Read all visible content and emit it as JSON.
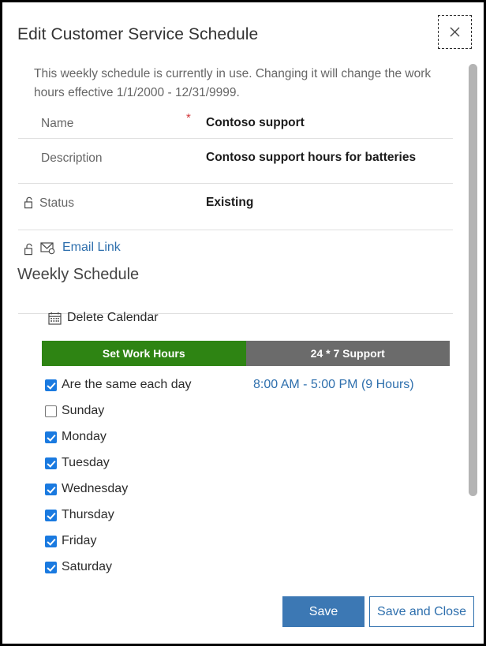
{
  "dialog": {
    "title": "Edit Customer Service Schedule",
    "close_icon": "close-icon",
    "notice": "This weekly schedule is currently in use. Changing it will change the work hours effective 1/1/2000 - 12/31/9999."
  },
  "fields": {
    "name": {
      "label": "Name",
      "required_marker": "*",
      "value": "Contoso support"
    },
    "description": {
      "label": "Description",
      "value": "Contoso support hours for batteries"
    },
    "status": {
      "label": "Status",
      "value": "Existing",
      "lock_icon": "unlock-icon"
    },
    "email": {
      "link_label": "Email Link",
      "lock_icon": "unlock-icon",
      "mail_icon": "email-link-icon"
    }
  },
  "weekly_schedule": {
    "section_title": "Weekly Schedule",
    "delete_calendar": {
      "label": "Delete Calendar",
      "icon": "calendar-icon"
    },
    "tabs": [
      {
        "label": "Set Work Hours",
        "active": true
      },
      {
        "label": "24 * 7 Support",
        "active": false
      }
    ],
    "same_each_day": {
      "label": "Are the same each day",
      "checked": true
    },
    "hours_link": "8:00 AM - 5:00 PM (9 Hours)",
    "days": [
      {
        "label": "Sunday",
        "checked": false
      },
      {
        "label": "Monday",
        "checked": true
      },
      {
        "label": "Tuesday",
        "checked": true
      },
      {
        "label": "Wednesday",
        "checked": true
      },
      {
        "label": "Thursday",
        "checked": true
      },
      {
        "label": "Friday",
        "checked": true
      },
      {
        "label": "Saturday",
        "checked": true
      }
    ]
  },
  "footer": {
    "save_label": "Save",
    "save_and_close_label": "Save and Close"
  },
  "colors": {
    "tab_active": "#2e8413",
    "tab_inactive": "#6b6b6b",
    "link": "#2e6fad",
    "primary_button": "#3c78b4",
    "checkbox_checked": "#1a7ae0",
    "required_asterisk": "#d13438"
  }
}
